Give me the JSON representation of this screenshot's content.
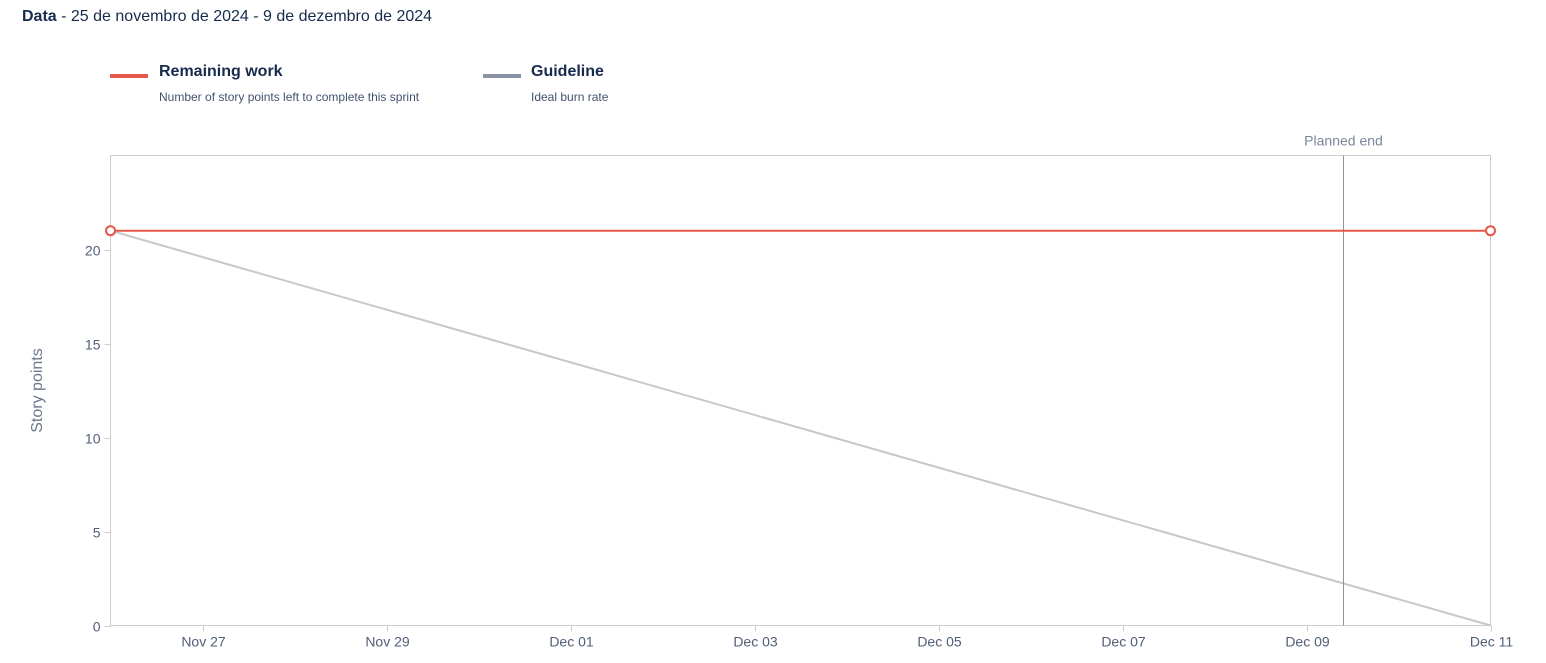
{
  "header": {
    "label": "Data",
    "range_text": " - 25 de novembro de 2024 - 9 de dezembro de 2024"
  },
  "legend": [
    {
      "name": "Remaining work",
      "description": "Number of story points left to complete this sprint",
      "color": "#e5584a"
    },
    {
      "name": "Guideline",
      "description": "Ideal burn rate",
      "color": "#8993a4"
    }
  ],
  "chart_data": {
    "type": "line",
    "ylabel": "Story points",
    "xlabel": "",
    "ylim": [
      0,
      25
    ],
    "yticks": [
      0,
      5,
      10,
      15,
      20
    ],
    "xlim": [
      "2024-11-26",
      "2024-12-11"
    ],
    "xticks": [
      {
        "date": "2024-11-27",
        "label": "Nov 27"
      },
      {
        "date": "2024-11-29",
        "label": "Nov 29"
      },
      {
        "date": "2024-12-01",
        "label": "Dec 01"
      },
      {
        "date": "2024-12-03",
        "label": "Dec 03"
      },
      {
        "date": "2024-12-05",
        "label": "Dec 05"
      },
      {
        "date": "2024-12-07",
        "label": "Dec 07"
      },
      {
        "date": "2024-12-09",
        "label": "Dec 09"
      },
      {
        "date": "2024-12-11",
        "label": "Dec 11"
      }
    ],
    "series": [
      {
        "name": "Remaining work",
        "color": "#e5584a",
        "points": [
          [
            "2024-11-26",
            21
          ],
          [
            "2024-12-11",
            21
          ]
        ]
      },
      {
        "name": "Guideline",
        "color": "#c8c8c8",
        "points": [
          [
            "2024-11-26",
            21
          ],
          [
            "2024-12-11",
            0
          ]
        ]
      }
    ],
    "markers": [
      {
        "label": "Planned end",
        "date": "2024-12-09",
        "color": "#8993a4"
      }
    ],
    "grid": false
  }
}
